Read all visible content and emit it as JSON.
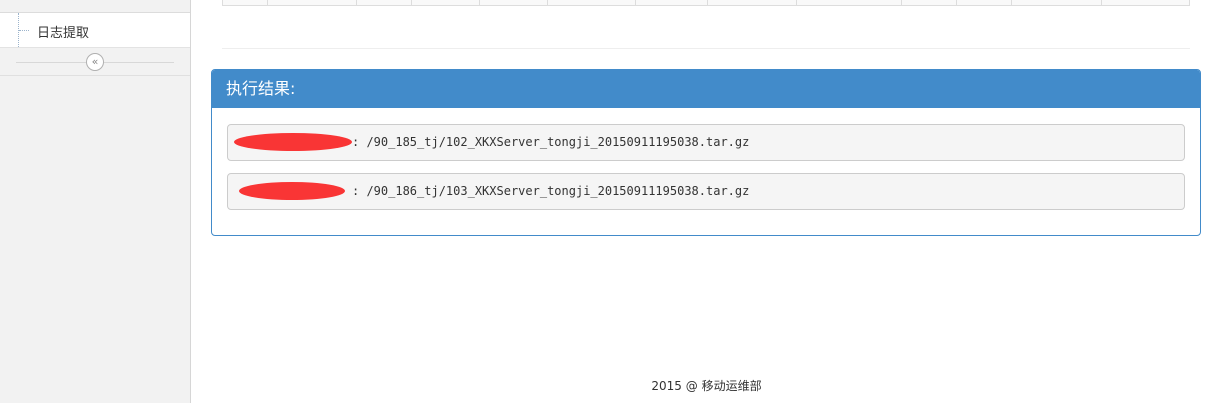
{
  "sidebar": {
    "items": [
      {
        "label": "日志提取"
      }
    ],
    "collapse_icon": "«"
  },
  "panel": {
    "title": "执行结果:",
    "results": [
      {
        "text": ": /90_185_tj/102_XKXServer_tongji_20150911195038.tar.gz"
      },
      {
        "text": ": /90_186_tj/103_XKXServer_tongji_20150911195038.tar.gz"
      }
    ]
  },
  "footer": {
    "text": "2015 @ 移动运维部"
  },
  "colors": {
    "panel_primary": "#428bca",
    "redaction": "#f93535",
    "sidebar_bg": "#f2f2f2"
  },
  "icons": {
    "collapse": "double-chevron-left-icon"
  }
}
